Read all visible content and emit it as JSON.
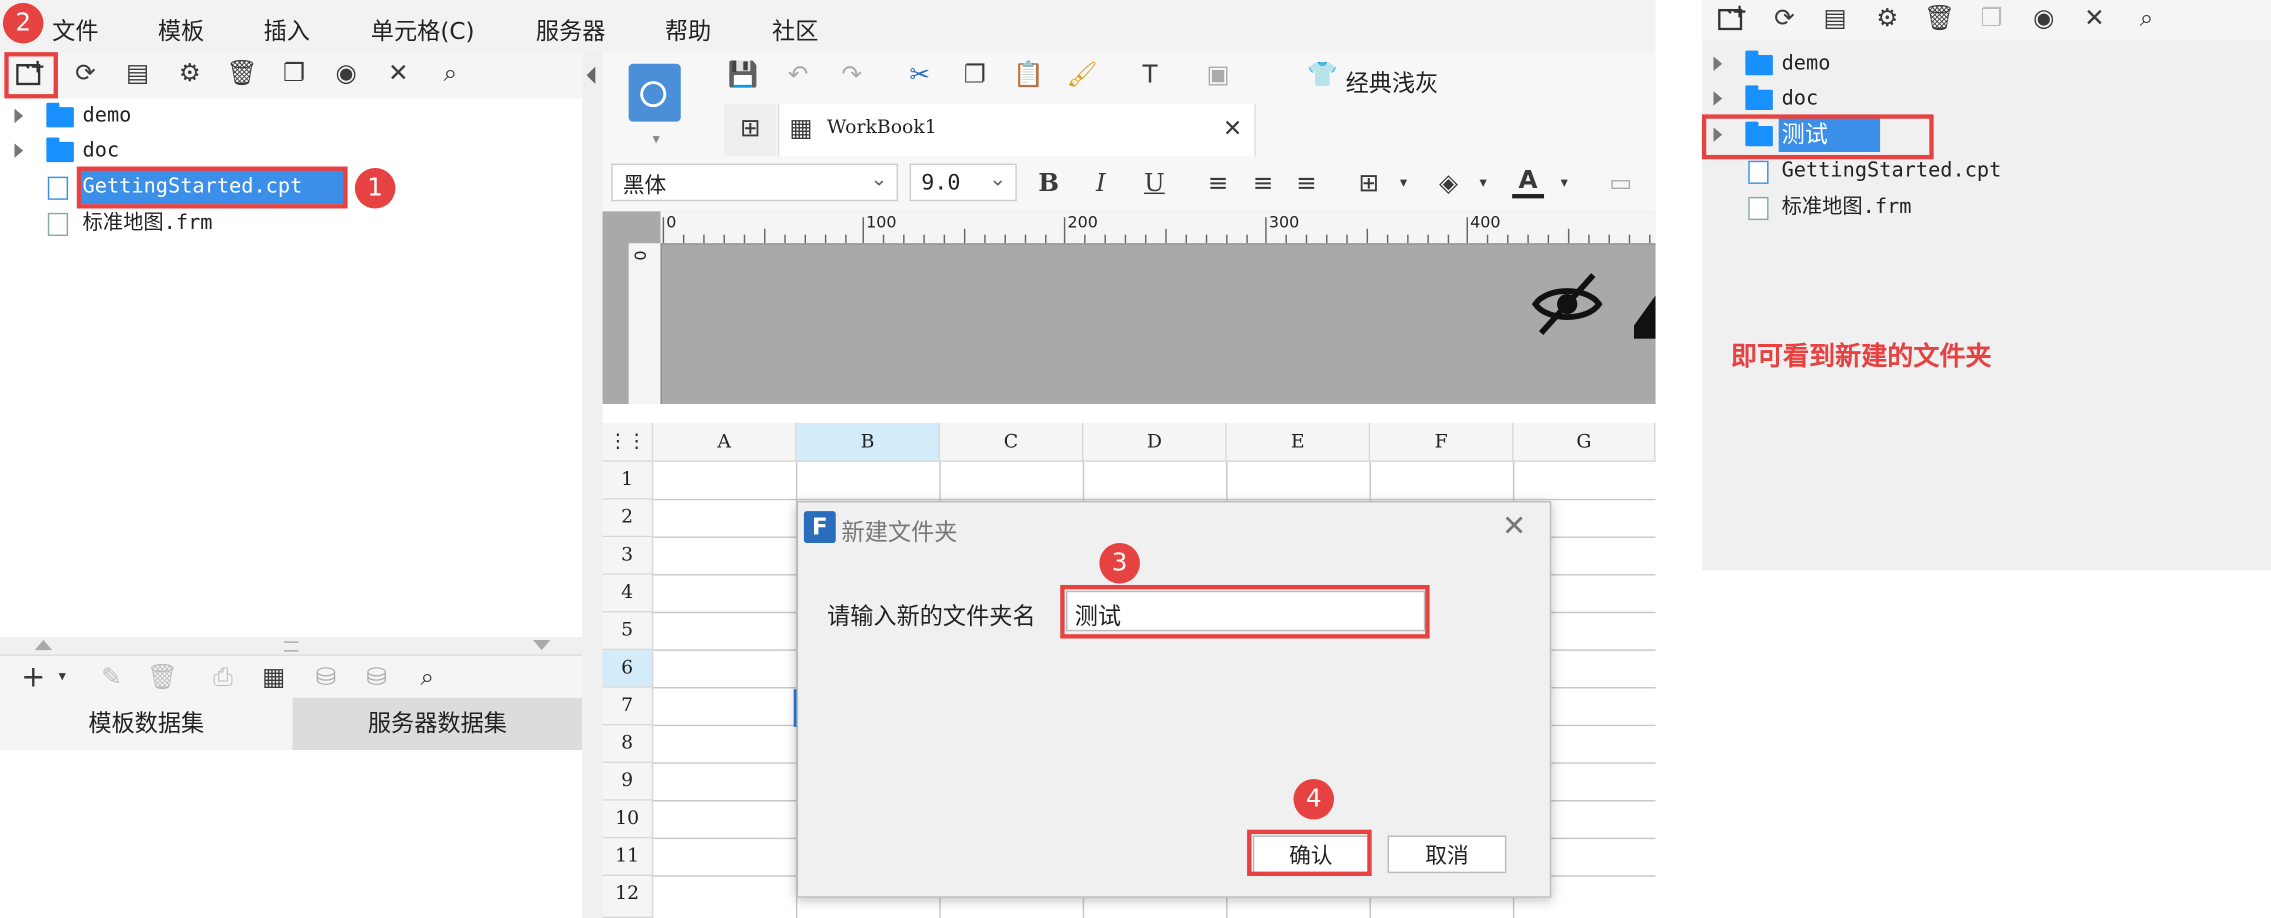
{
  "menu": [
    "文件",
    "模板",
    "插入",
    "单元格(C)",
    "服务器",
    "帮助",
    "社区"
  ],
  "tree": {
    "items": [
      {
        "label": "demo",
        "type": "folder"
      },
      {
        "label": "doc",
        "type": "folder"
      },
      {
        "label": "GettingStarted.cpt",
        "type": "cpt"
      },
      {
        "label": "标准地图.frm",
        "type": "frm"
      }
    ]
  },
  "badges": {
    "b1": "1",
    "b2": "2",
    "b3": "3",
    "b4": "4"
  },
  "dataset_tabs": {
    "template": "模板数据集",
    "server": "服务器数据集"
  },
  "toolbar": {
    "theme_label": "经典浅灰"
  },
  "workbook_tab": "WorkBook1",
  "format": {
    "font": "黑体",
    "size": "9.0",
    "bold": "B",
    "italic": "I",
    "underline": "U"
  },
  "ruler": {
    "marks": [
      "0",
      "100",
      "200",
      "300",
      "400"
    ],
    "vmark": "0"
  },
  "grid": {
    "columns": [
      "A",
      "B",
      "C",
      "D",
      "E",
      "F",
      "G"
    ],
    "rows": [
      "1",
      "2",
      "3",
      "4",
      "5",
      "6",
      "7",
      "8",
      "9",
      "10",
      "11",
      "12"
    ],
    "selected_column": "B",
    "selected_row": "6"
  },
  "dialog": {
    "title": "新建文件夹",
    "prompt": "请输入新的文件夹名",
    "input_value": "测试",
    "ok_label": "确认",
    "cancel_label": "取消"
  },
  "right_tree": {
    "items": [
      {
        "label": "demo",
        "type": "folder"
      },
      {
        "label": "doc",
        "type": "folder"
      },
      {
        "label": "测试",
        "type": "folder"
      },
      {
        "label": "GettingStarted.cpt",
        "type": "cpt"
      },
      {
        "label": "标准地图.frm",
        "type": "frm"
      }
    ]
  },
  "annotation": "即可看到新建的文件夹",
  "colors": {
    "accent_red": "#e64242",
    "selected_blue": "#3b8fe8",
    "folder_blue": "#1890ff"
  }
}
